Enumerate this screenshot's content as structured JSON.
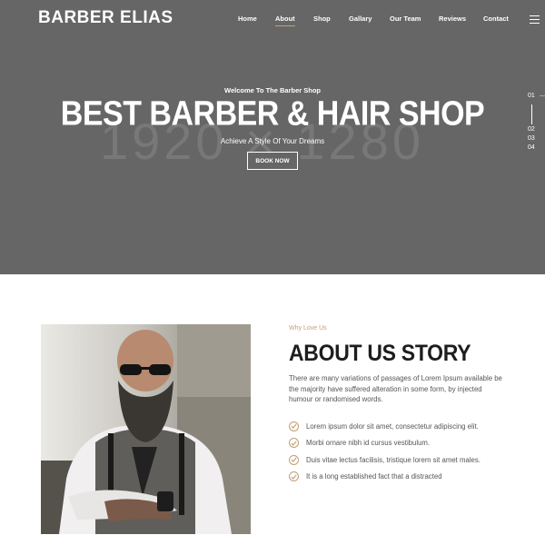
{
  "brand": {
    "logo": "BARBER ELIAS"
  },
  "nav": {
    "items": [
      "Home",
      "About",
      "Shop",
      "Gallary",
      "Our Team",
      "Reviews",
      "Contact"
    ],
    "active": "About"
  },
  "hero": {
    "welcome": "Welcome To The Barber Shop",
    "headline": "BEST BARBER & HAIR SHOP",
    "watermark": "1920 × 1280",
    "subtitle": "Achieve A Style Of Your Dreams",
    "button": "BOOK NOW",
    "slides": [
      "01",
      "02",
      "03",
      "04"
    ],
    "active_slide": "01"
  },
  "about": {
    "eyebrow": "Why Love Us",
    "title": "ABOUT US STORY",
    "paragraph": "There are many variations of passages of Lorem Ipsum available be the majority have suffered alteration in some form, by injected humour or randomised words.",
    "features": [
      "Lorem ipsum dolor sit amet, consectetur adipiscing elit.",
      "Morbi ornare nibh id cursus vestibulum.",
      "Duis vitae lectus facilisis, tristique lorem sit amet males.",
      "It is a long established fact that a distracted"
    ]
  },
  "colors": {
    "accent": "#c29e72",
    "hero_bg": "#666666",
    "heading": "#1d1d1d",
    "body_text": "#555555"
  },
  "icons": {
    "menu": "hamburger-menu-icon",
    "check": "check-circle-icon"
  }
}
